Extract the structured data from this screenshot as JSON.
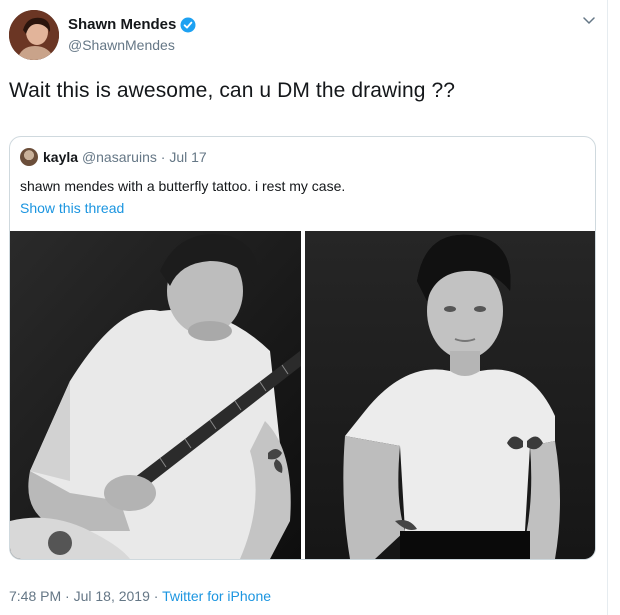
{
  "author": {
    "display_name": "Shawn Mendes",
    "handle": "@ShawnMendes",
    "verified": true,
    "avatar_icon": "profile-photo"
  },
  "tweet": {
    "text": "Wait this is awesome, can u DM the drawing ??"
  },
  "quoted": {
    "display_name": "kayla",
    "handle": "@nasaruins",
    "separator": " · ",
    "date": "Jul 17",
    "text": "shawn mendes with a butterfly tattoo. i rest my case.",
    "thread_link": "Show this thread",
    "photos": [
      "photo-guitar",
      "photo-portrait"
    ]
  },
  "footer": {
    "timestamp": "7:48 PM · Jul 18, 2019",
    "separator": " · ",
    "source": "Twitter for iPhone"
  },
  "colors": {
    "link": "#1b95e0",
    "secondary_text": "#657786",
    "verified_badge": "#1da1f2",
    "border": "#cfd9de"
  },
  "icons": {
    "verified": "verified-badge-icon",
    "more": "chevron-down-icon"
  }
}
